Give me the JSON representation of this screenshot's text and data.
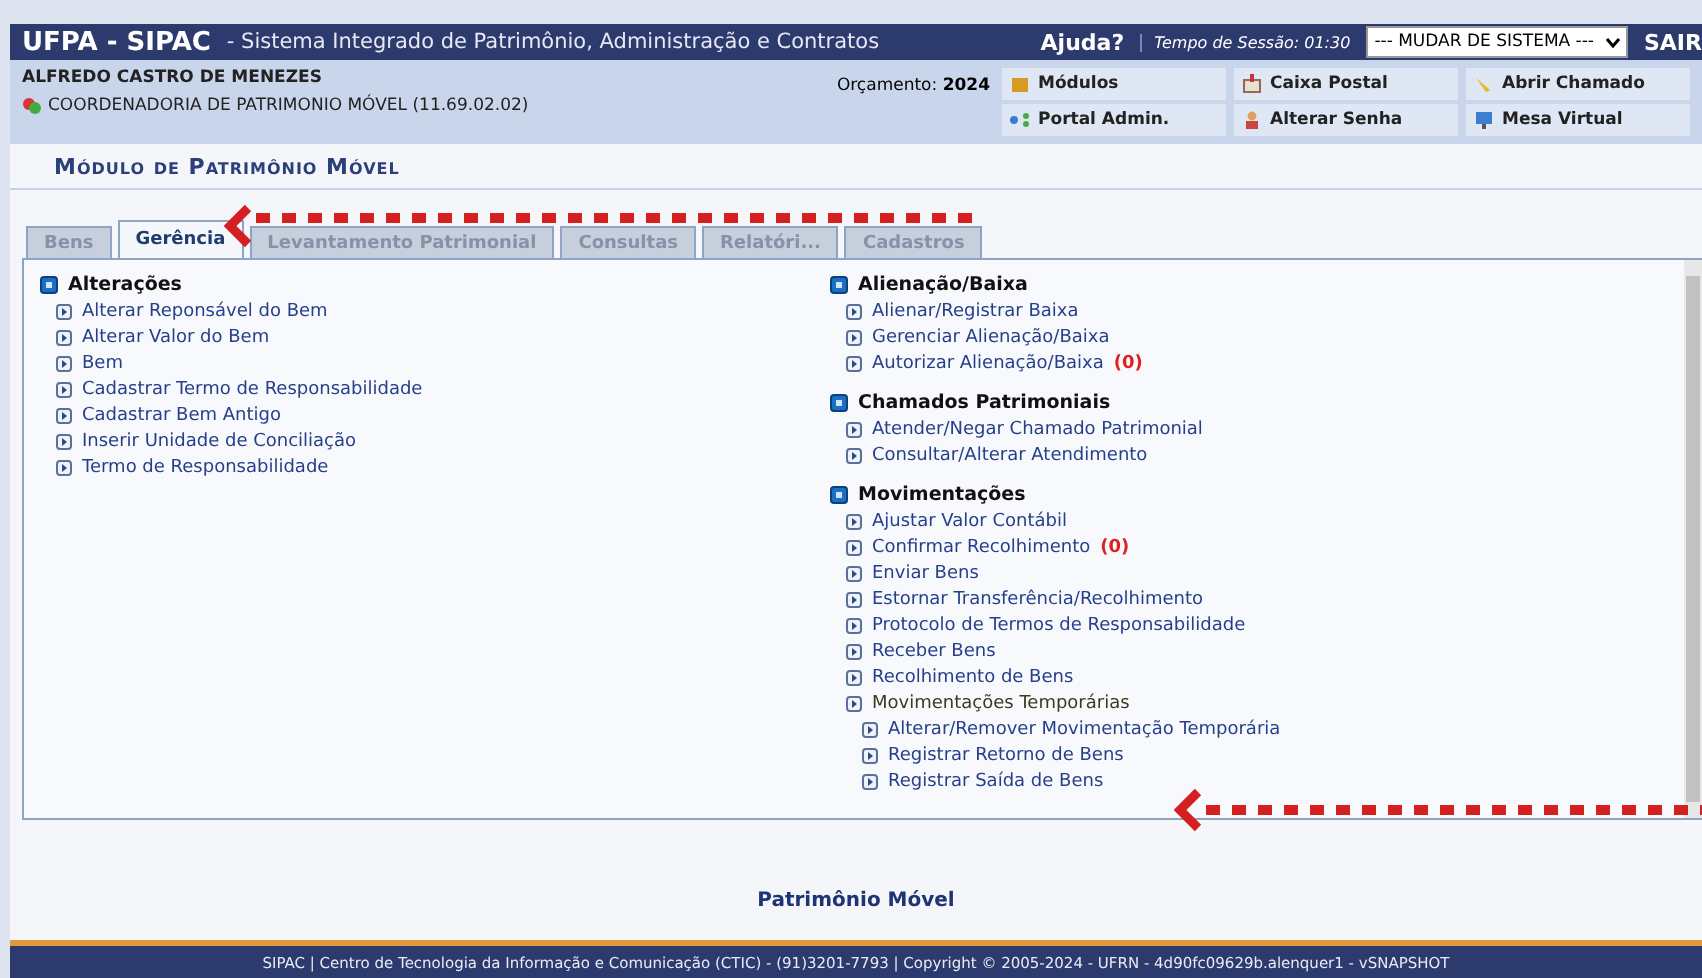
{
  "header": {
    "brand": "UFPA - SIPAC",
    "subtitle": "- Sistema Integrado de Patrimônio, Administração e Contratos",
    "help": "Ajuda?",
    "session_label": "Tempo de Sessão:",
    "session_time": "01:30",
    "system_select": "--- MUDAR DE SISTEMA ---",
    "logout": "SAIR"
  },
  "user": {
    "name": "ALFREDO CASTRO DE MENEZES",
    "unit": "COORDENADORIA DE PATRIMONIO MÓVEL (11.69.02.02)",
    "budget_label": "Orçamento:",
    "budget_year": "2024"
  },
  "shortcuts": [
    {
      "label": "Módulos",
      "kind": "box"
    },
    {
      "label": "Caixa Postal",
      "kind": "mail"
    },
    {
      "label": "Abrir Chamado",
      "kind": "horn"
    },
    {
      "label": "Portal Admin.",
      "kind": "network"
    },
    {
      "label": "Alterar Senha",
      "kind": "person"
    },
    {
      "label": "Mesa Virtual",
      "kind": "monitor"
    }
  ],
  "module_title": "Módulo de Patrimônio Móvel",
  "tabs": [
    {
      "label": "Bens",
      "selected": false
    },
    {
      "label": "Gerência",
      "selected": true
    },
    {
      "label": "Levantamento Patrimonial",
      "selected": false
    },
    {
      "label": "Consultas",
      "selected": false
    },
    {
      "label": "Relatóri...",
      "selected": false
    },
    {
      "label": "Cadastros",
      "selected": false
    }
  ],
  "columns": [
    [
      {
        "title": "Alterações",
        "items": [
          {
            "label": "Alterar Reponsável do Bem"
          },
          {
            "label": "Alterar Valor do Bem"
          },
          {
            "label": "Bem"
          },
          {
            "label": "Cadastrar Termo de Responsabilidade"
          },
          {
            "label": "Cadastrar Bem Antigo"
          },
          {
            "label": "Inserir Unidade de Conciliação"
          },
          {
            "label": "Termo de Responsabilidade"
          }
        ]
      }
    ],
    [
      {
        "title": "Alienação/Baixa",
        "items": [
          {
            "label": "Alienar/Registrar Baixa"
          },
          {
            "label": "Gerenciar Alienação/Baixa"
          },
          {
            "label": "Autorizar Alienação/Baixa",
            "count": "(0)"
          }
        ]
      },
      {
        "title": "Chamados Patrimoniais",
        "items": [
          {
            "label": "Atender/Negar Chamado Patrimonial"
          },
          {
            "label": "Consultar/Alterar Atendimento"
          }
        ]
      },
      {
        "title": "Movimentações",
        "items": [
          {
            "label": "Ajustar Valor Contábil"
          },
          {
            "label": "Confirmar Recolhimento",
            "count": "(0)"
          },
          {
            "label": "Enviar Bens"
          },
          {
            "label": "Estornar Transferência/Recolhimento"
          },
          {
            "label": "Protocolo de Termos de Responsabilidade"
          },
          {
            "label": "Receber Bens"
          },
          {
            "label": "Recolhimento de Bens"
          },
          {
            "label": "Movimentações Temporárias",
            "children": [
              {
                "label": "Alterar/Remover Movimentação Temporária"
              },
              {
                "label": "Registrar Retorno de Bens"
              },
              {
                "label": "Registrar Saída de Bens"
              }
            ]
          }
        ]
      }
    ]
  ],
  "footer_title": "Patrimônio Móvel",
  "status_bar": "SIPAC | Centro de Tecnologia da Informação e Comunicação (CTIC) - (91)3201-7793 | Copyright © 2005-2024 - UFRN - 4d90fc09629b.alenquer1 - vSNAPSHOT"
}
